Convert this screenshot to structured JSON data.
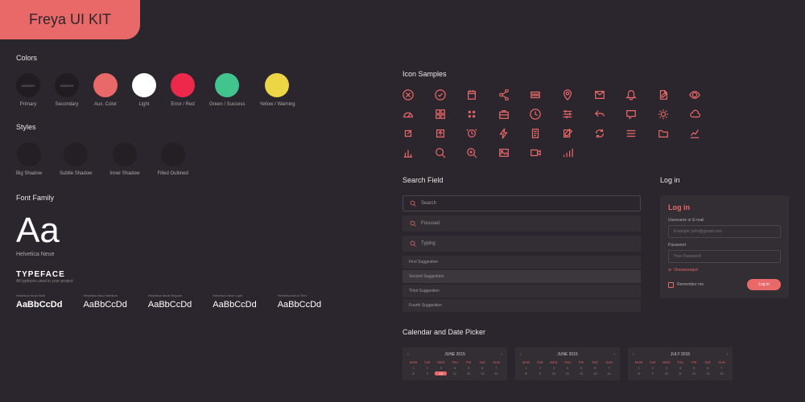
{
  "header": {
    "title": "Freya UI KIT"
  },
  "colors": {
    "title": "Colors",
    "items": [
      {
        "hex": "#2B262D",
        "label": "Primary"
      },
      {
        "hex": "#2B262D",
        "label": "Secondary"
      },
      {
        "hex": "#E96A6A",
        "label": "Aux. Color"
      },
      {
        "hex": "#FFFFFF",
        "label": "Light"
      },
      {
        "hex": "#EC294B",
        "label": "Error / Red"
      },
      {
        "hex": "#42B44E",
        "label": "Green / Success"
      },
      {
        "hex": "#ECB232",
        "label": "Yellow / Warning"
      }
    ]
  },
  "styles": {
    "title": "Styles",
    "items": [
      "Big Shadow",
      "Subtle Shadow",
      "Inner Shadow",
      "Filled Outlined"
    ]
  },
  "font": {
    "title": "Font Family",
    "sample": "Aa",
    "name": "Helvetica Neue",
    "typeface_h": "TYPEFACE",
    "typeface_s": "All typfaces used in your project",
    "weights": [
      {
        "label": "Helvetica Neue Bold",
        "sample": "AaBbCcDd"
      },
      {
        "label": "Helvetica Neue Medium",
        "sample": "AaBbCcDd"
      },
      {
        "label": "Helvetica Neue Regular",
        "sample": "AaBbCcDd"
      },
      {
        "label": "Helvetica Neue Light",
        "sample": "AaBbCcDd"
      },
      {
        "label": "Helvetica Neue Thin",
        "sample": "AaBbCcDd"
      }
    ]
  },
  "icons": {
    "title": "Icon Samples",
    "names": [
      "close-circle",
      "check-circle",
      "calendar",
      "share",
      "layers",
      "pin",
      "mail",
      "bell",
      "edit-doc",
      "eye",
      "speed",
      "grid",
      "dots",
      "briefcase",
      "clock",
      "sliders",
      "reply",
      "comment",
      "brightness",
      "cloud",
      "external",
      "arrow-up",
      "alarm",
      "flash",
      "note",
      "compose",
      "refresh",
      "menu",
      "folder",
      "chart-line",
      "chart-bar",
      "search",
      "zoom",
      "image",
      "video",
      "signal"
    ]
  },
  "search": {
    "title": "Search Field",
    "placeholder": "Search",
    "focused": "Focused",
    "typing": "Typing",
    "suggestions": [
      "First Suggestion",
      "Second Suggestion",
      "Third Suggestion",
      "Fourth Suggestion"
    ]
  },
  "login": {
    "title": "Log in",
    "heading": "Log in",
    "user_label": "Username or E-mail",
    "user_placeholder": "Example: john@gmail.com",
    "pass_label": "Password",
    "pass_placeholder": "Your Password",
    "error": "Oooooooops!",
    "remember": "Remember me",
    "button": "Log in"
  },
  "calendar": {
    "title": "Calendar and Date Picker",
    "months": [
      "JUNE 2015",
      "JUNE 2015",
      "JULY 2015"
    ],
    "dow": [
      "MON",
      "TUE",
      "WED",
      "THU",
      "FRI",
      "SAT",
      "SUN"
    ]
  }
}
